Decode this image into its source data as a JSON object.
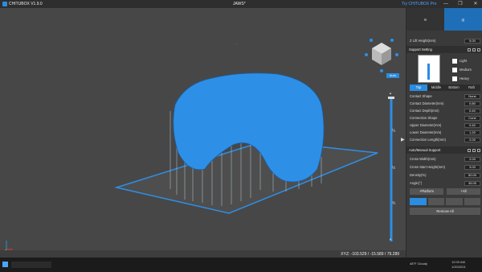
{
  "titlebar": {
    "app_name": "CHITUBOX V1.9.0",
    "document": "JAWS*",
    "promo": "Try CHITUBOX Pro",
    "minimize": "—",
    "maximize": "❐",
    "close": "✕"
  },
  "view": {
    "auto_button": "Auto",
    "slider_top": "¼",
    "slider_mid": "½",
    "slider_bot": "¾",
    "arrow_up": "▲",
    "arrow_down": "▼"
  },
  "panel": {
    "z_lift_label": "Z Lift Height(mm)",
    "z_lift_value": "5.00",
    "support_setting": "Support Setting",
    "density_options": [
      "Light",
      "Medium",
      "Heavy"
    ],
    "tabs": [
      "Top",
      "Middle",
      "Bottom",
      "Raft"
    ],
    "fields": [
      {
        "label": "Contact Shape",
        "value": "None"
      },
      {
        "label": "Contact Diameter(mm)",
        "value": "0.80"
      },
      {
        "label": "Contact Depth(mm)",
        "value": "0.40"
      },
      {
        "label": "Connection Shape",
        "value": "Cone"
      },
      {
        "label": "Upper Diameter(mm)",
        "value": "0.40"
      },
      {
        "label": "Lower Diameter(mm)",
        "value": "1.20"
      },
      {
        "label": "Connection Length(mm)",
        "value": "2.00"
      }
    ],
    "auto_manual": "Auto/Manual Support",
    "cross_fields": [
      {
        "label": "Cross Width(mm)",
        "value": "2.00"
      },
      {
        "label": "Cross Start Height(mm)",
        "value": "3.00"
      },
      {
        "label": "Density(%)",
        "value": "50.00"
      },
      {
        "label": "Angle(°)",
        "value": "45.00"
      }
    ],
    "platform_btn": "+Platform",
    "all_btn": "+All",
    "remove_all": "Remove All"
  },
  "status": {
    "xyz": "XYZ: -103.529 / -15.589 / 79.289"
  },
  "taskbar": {
    "weather": "48°F Cloudy",
    "time": "12:00 AM",
    "date": "1/20/2021"
  }
}
